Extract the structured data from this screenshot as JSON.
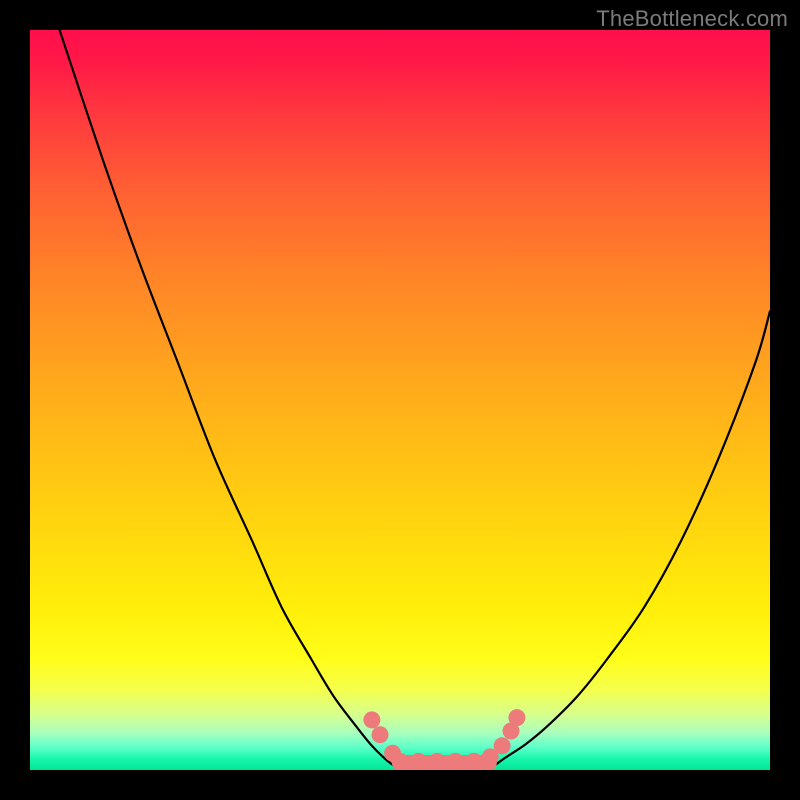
{
  "watermark": "TheBottleneck.com",
  "colors": {
    "page_bg": "#000000",
    "watermark": "#7b7b7b",
    "curve": "#000000",
    "marker": "#ed7b7b"
  },
  "chart_data": {
    "type": "line",
    "title": "",
    "xlabel": "",
    "ylabel": "",
    "xlim": [
      0,
      100
    ],
    "ylim": [
      0,
      100
    ],
    "grid": false,
    "legend": false,
    "series": [
      {
        "name": "left-branch",
        "x": [
          4,
          10,
          15,
          20,
          25,
          30,
          34,
          38,
          41,
          44,
          46,
          48,
          50
        ],
        "values": [
          100,
          82,
          68,
          55,
          42,
          31,
          22,
          15,
          10,
          6,
          3.5,
          1.5,
          0
        ]
      },
      {
        "name": "right-branch",
        "x": [
          62,
          64,
          67,
          70,
          74,
          78,
          83,
          88,
          93,
          98,
          100
        ],
        "values": [
          0,
          1.5,
          3.5,
          6,
          10,
          15,
          22,
          31,
          42,
          55,
          62
        ]
      },
      {
        "name": "floor",
        "x": [
          50,
          62
        ],
        "values": [
          0,
          0
        ]
      }
    ],
    "markers": [
      {
        "x": 46.2,
        "y": 6.5
      },
      {
        "x": 47.3,
        "y": 4.5
      },
      {
        "x": 49.0,
        "y": 2.0
      },
      {
        "x": 50.0,
        "y": 0.9
      },
      {
        "x": 52.5,
        "y": 0.9
      },
      {
        "x": 55.0,
        "y": 0.9
      },
      {
        "x": 57.5,
        "y": 0.9
      },
      {
        "x": 60.0,
        "y": 0.9
      },
      {
        "x": 62.2,
        "y": 1.5
      },
      {
        "x": 63.8,
        "y": 3.0
      },
      {
        "x": 65.0,
        "y": 5.0
      },
      {
        "x": 65.8,
        "y": 6.8
      }
    ],
    "gradient_stops": [
      {
        "p": 0,
        "c": "#ff0f4c"
      },
      {
        "p": 4,
        "c": "#ff1848"
      },
      {
        "p": 12,
        "c": "#ff3b3e"
      },
      {
        "p": 22,
        "c": "#ff6133"
      },
      {
        "p": 33,
        "c": "#ff8328"
      },
      {
        "p": 45,
        "c": "#ffa21e"
      },
      {
        "p": 57,
        "c": "#ffbf15"
      },
      {
        "p": 68,
        "c": "#ffd80e"
      },
      {
        "p": 78,
        "c": "#ffee0a"
      },
      {
        "p": 85,
        "c": "#fffd1a"
      },
      {
        "p": 89,
        "c": "#f6ff4a"
      },
      {
        "p": 92.5,
        "c": "#d7ff8e"
      },
      {
        "p": 95,
        "c": "#a8ffbe"
      },
      {
        "p": 97,
        "c": "#5cffc9"
      },
      {
        "p": 98.5,
        "c": "#18f7ac"
      },
      {
        "p": 100,
        "c": "#00e597"
      }
    ]
  }
}
